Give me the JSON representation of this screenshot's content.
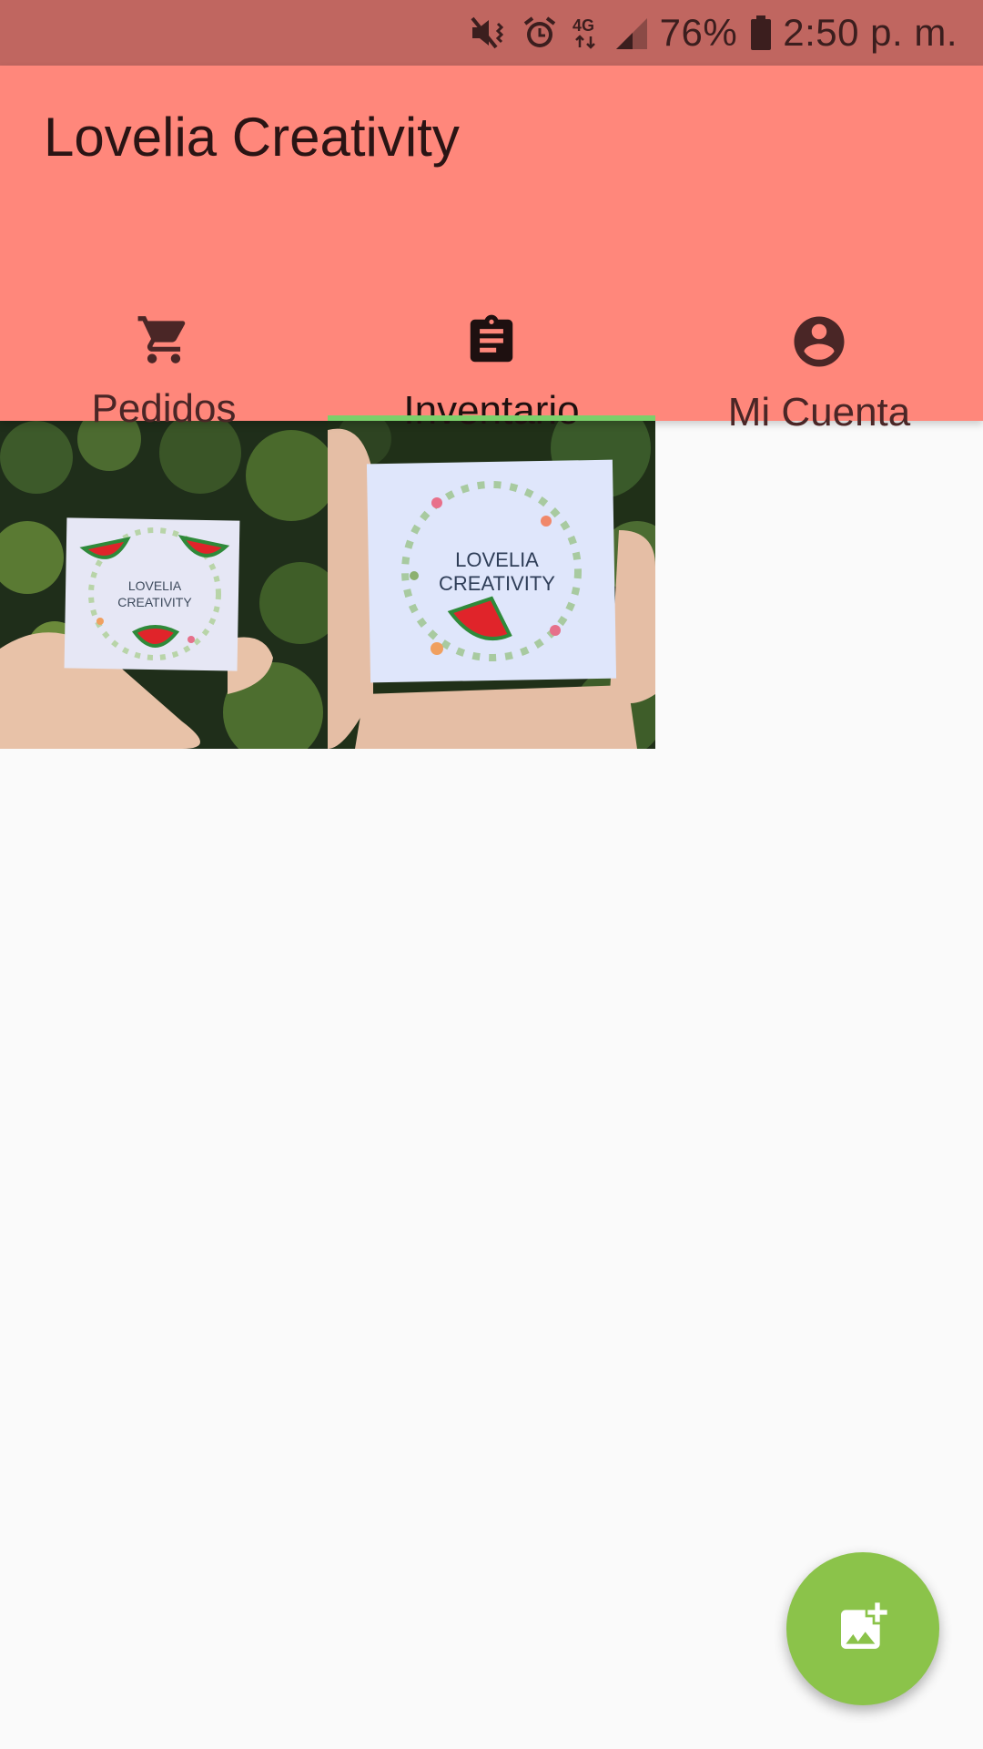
{
  "status_bar": {
    "battery_text": "76%",
    "time": "2:50 p. m.",
    "network_text": "4G",
    "icons": [
      "mute-vibrate-icon",
      "alarm-icon",
      "network-4g-icon",
      "signal-icon",
      "battery-icon"
    ]
  },
  "app_bar": {
    "title": "Lovelia Creativity",
    "color": "#ff877b"
  },
  "tabs": [
    {
      "label": "Pedidos",
      "icon": "cart-icon",
      "active": false
    },
    {
      "label": "Inventario",
      "icon": "clipboard-icon",
      "active": true
    },
    {
      "label": "Mi Cuenta",
      "icon": "account-circle-icon",
      "active": false
    }
  ],
  "inventory": {
    "items": [
      {
        "card_text": [
          "LOVELIA",
          "CREATIVITY"
        ],
        "icon": "product-photo"
      },
      {
        "card_text": [
          "LOVELIA",
          "CREATIVITY"
        ],
        "icon": "product-photo"
      }
    ]
  },
  "fab": {
    "icon": "add-photo-icon",
    "color": "#8bc34a"
  },
  "colors": {
    "status_bar": "#c06660",
    "tab_indicator": "#7bd06a",
    "background": "#fafafa"
  }
}
